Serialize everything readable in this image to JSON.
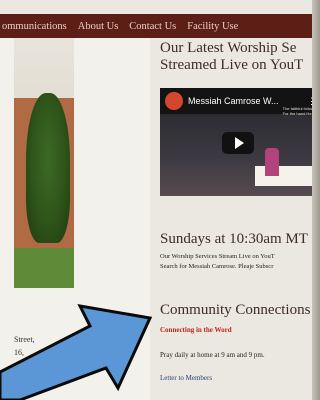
{
  "nav": {
    "items": [
      "ommunications",
      "About Us",
      "Contact Us",
      "Facility Use"
    ]
  },
  "sidebar": {
    "address_line1": "Street,",
    "address_line2": "16,"
  },
  "main": {
    "worship_heading_line1": "Our Latest Worship Se",
    "worship_heading_line2": "Streamed Live on YouT",
    "video": {
      "channel_title": "Messiah Camrose W...",
      "caption_line1": "The faithful followe",
      "caption_line2": "For the hand He",
      "menu_glyph": "⋮",
      "channel_icon": "channel-avatar-icon",
      "play_icon": "play-icon"
    },
    "sundays_heading": "Sundays at 10:30am MT",
    "stream_line1": "Our Worship Services Stream Live on YouT",
    "stream_line2": "Search for Messiah Camrose. Pleaje Subscr",
    "community_heading": "Community Connections",
    "connect_link": "Connecting in the Word",
    "pray_text": "Pray daily at home at 9 am and 9 pm.",
    "letter_link": "Letter to Members"
  },
  "colors": {
    "nav_bg": "#5b1f15",
    "link_red": "#c0241c",
    "arrow_blue": "#5b97d6"
  }
}
